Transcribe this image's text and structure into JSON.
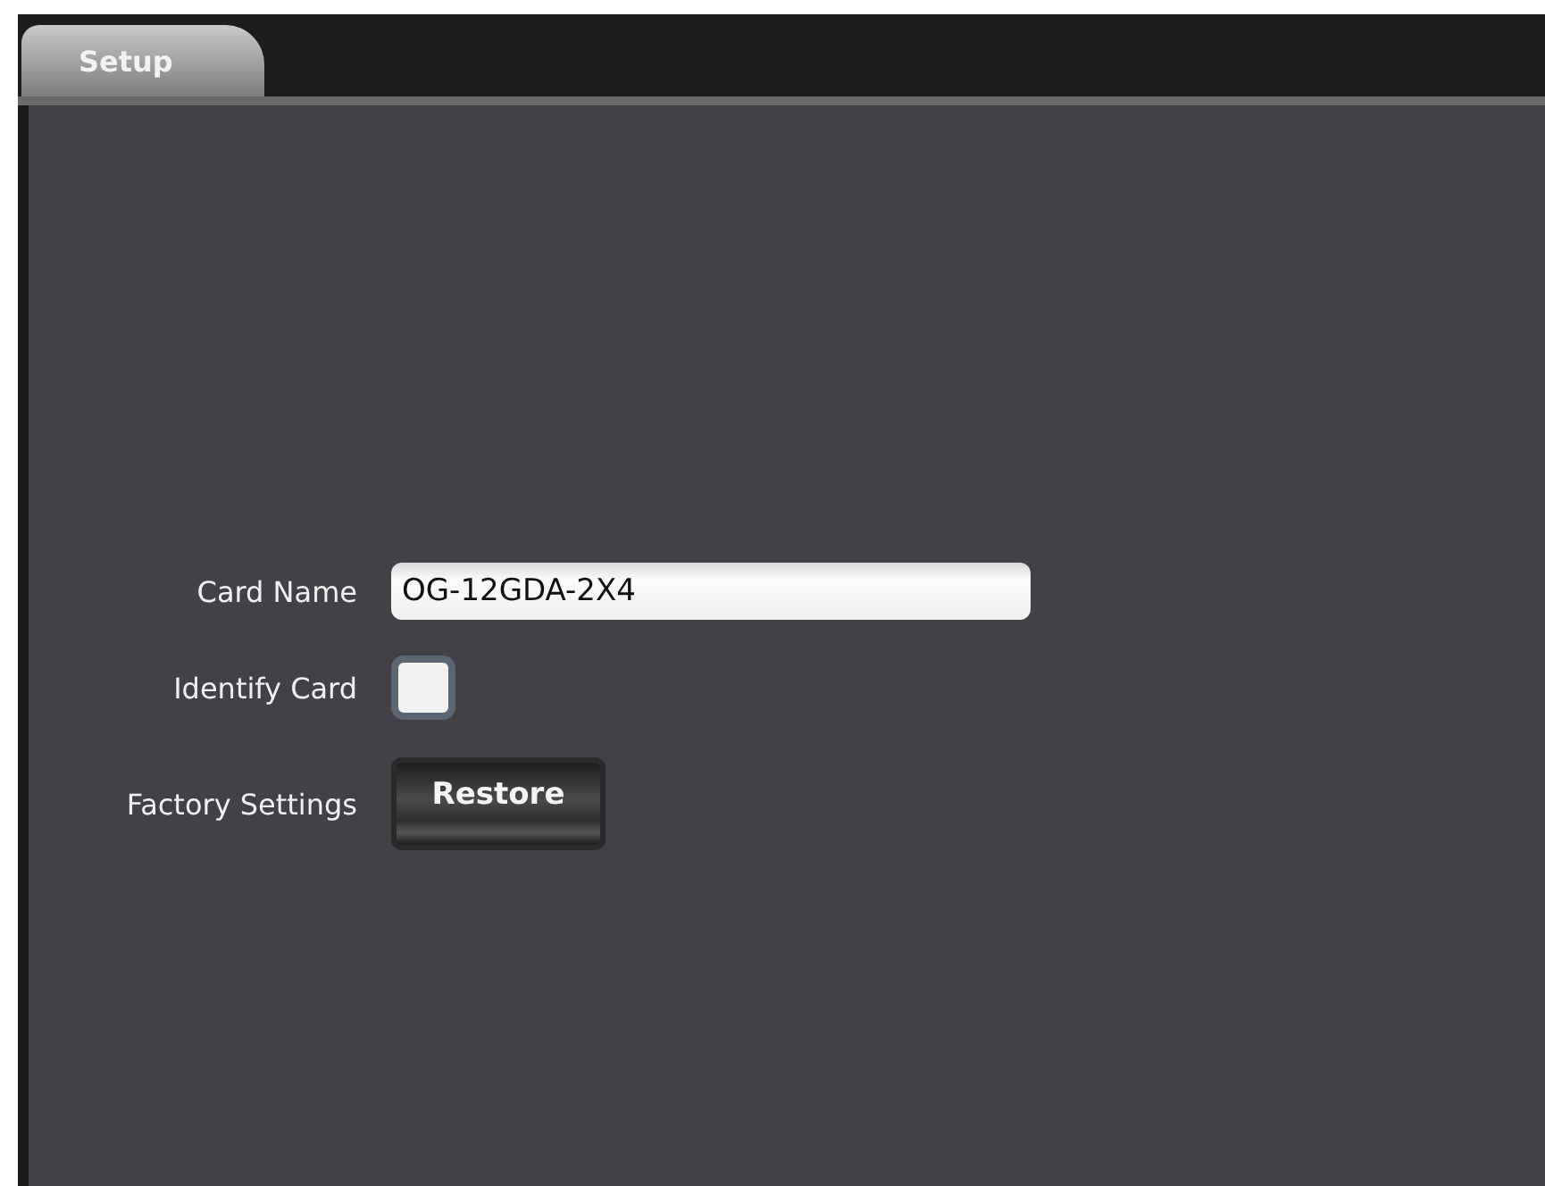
{
  "tabs": [
    {
      "label": "Setup",
      "selected": true
    }
  ],
  "fields": [
    {
      "kind": "text",
      "label": "Card Name",
      "value": "OG-12GDA-2X4"
    },
    {
      "kind": "checkbox",
      "label": "Identify Card",
      "checked": false
    },
    {
      "kind": "button",
      "label": "Factory Settings",
      "button": "Restore"
    }
  ]
}
